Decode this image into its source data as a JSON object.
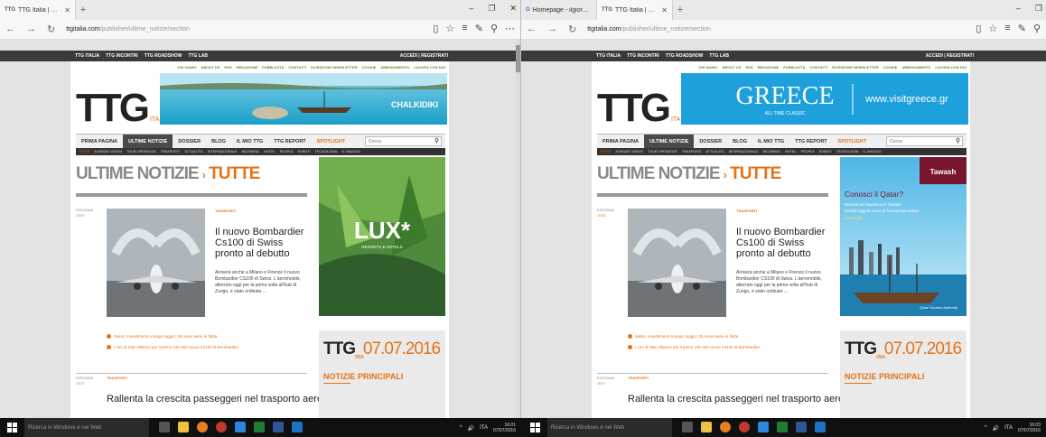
{
  "left": {
    "tabs": [
      {
        "favicon": "TTG",
        "title": "TTG Italia | Notizie, infor",
        "active": true
      }
    ],
    "url_host": "ttgitalia.com",
    "url_path": "/publisher/ultime_notizie/section",
    "banner_text": "CHALKIDIKI",
    "clock_time": "16:01",
    "clock_date": "07/07/2016"
  },
  "right": {
    "tabs": [
      {
        "favicon": "G",
        "title": "Homepage - ilgiornaledelt",
        "active": false
      },
      {
        "favicon": "TTG",
        "title": "TTG Italia | Notizie, infor",
        "active": true
      }
    ],
    "url_host": "ttgitalia.com",
    "url_path": "/publisher/ultime_notizie/section",
    "banner_title": "GREECE",
    "banner_sub": "ALL TIME CLASSIC",
    "banner_url": "www.visitgreece.gr",
    "ad_brand": "Tawash",
    "ad_title": "Conosci il Qatar?",
    "ad_line1": "Diventa un esperto con Tawash",
    "ad_line2": "Iscriviti oggi al corso di formazione online",
    "ad_cta": "Clicca qui",
    "ad_footer": "Qatar Tourism Authority",
    "clock_time": "16:03",
    "clock_date": "07/07/2016"
  },
  "site": {
    "top_links": [
      "TTG ITALIA",
      "TTG INCONTRI",
      "TTG ROADSHOW",
      "TTG LAB"
    ],
    "account": "ACCEDI | REGISTRATI",
    "utility": [
      "CHI SIAMO",
      "ABOUT US",
      "RSS",
      "REDAZIONE",
      "PUBBLICITÀ",
      "CONTATTI",
      "ISCRIZIONE NEWSLETTER",
      "COOKIE",
      "ABBONAMENTO",
      "LAVORA CON NOI"
    ],
    "logo": "TTG",
    "logo_sub": "ITALIA",
    "menu": [
      "PRIMA PAGINA",
      "ULTIME NOTIZIE",
      "DOSSIER",
      "BLOG",
      "IL MIO TTG",
      "TTG REPORT",
      "SPOTLIGHT"
    ],
    "search_placeholder": "Cerca",
    "submenu": [
      "TUTTE",
      "AGENZIE VIAGGI",
      "TOUR OPERATOR",
      "TRASPORTI",
      "ATTUALITÀ",
      "INTERNAZIONALE",
      "INCOMING",
      "HOTEL",
      "PEOPLE",
      "EVENTI",
      "TECNOLOGIA",
      "IL VIAGGIO"
    ],
    "headline_main": "ULTIME NOTIZIE",
    "headline_sep": "›",
    "headline_sub": "TUTTE",
    "article1": {
      "date": "07/07/2016",
      "time": "15:50",
      "category": "TRASPORTI",
      "title": "Il nuovo Bombardier Cs100 di Swiss pronto al debutto",
      "body": "Arriverà anche a Milano e Firenze il nuovo Bombardier CS100 di Swiss. L'aeromobile, atterrato oggi per la prima volta all'hub di Zurigo, è stato ordinato ..."
    },
    "related": [
      "Swiss, investimenti a lungo raggio: 35 nuovi aerei in flotta",
      "I ceo di Star Alliance per il primo volo del nuovo Cs100 di Bombardier"
    ],
    "article2": {
      "date": "07/07/2016",
      "time": "15:37",
      "category": "TRASPORTI",
      "title": "Rallenta la crescita passeggeri nel trasporto aereo"
    },
    "lux_title": "LUX*",
    "lux_sub": "RESORTS & HOTELS",
    "datebox_ttg": "TTG",
    "datebox_italia": "ITALIA",
    "datebox_date": "07.07.2016",
    "notizie": "NOTIZIE PRINCIPALI"
  },
  "taskbar": {
    "search_placeholder": "Ricerca in Windows e nel Web",
    "lang": "ITA"
  }
}
